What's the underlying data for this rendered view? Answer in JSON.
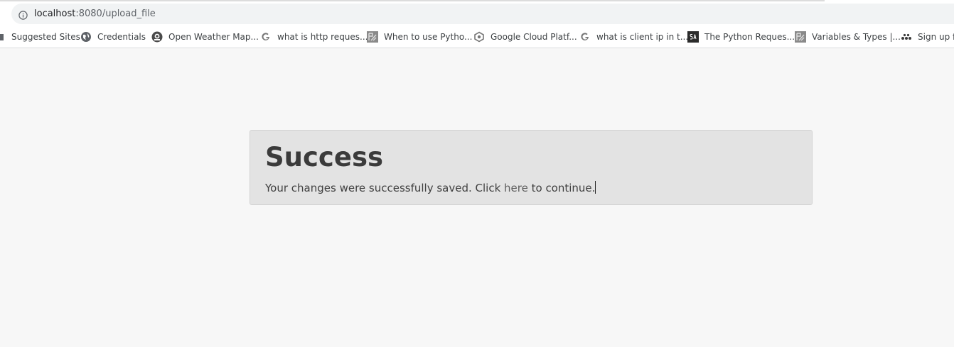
{
  "browser": {
    "url_host": "localhost",
    "url_path": ":8080/upload_file",
    "bookmarks": [
      {
        "label": "Suggested Sites",
        "icon": "suggested-sites-icon"
      },
      {
        "label": "Credentials",
        "icon": "globe-icon"
      },
      {
        "label": "Open Weather Map...",
        "icon": "openweathermap-icon"
      },
      {
        "label": "what is http reques...",
        "icon": "google-icon"
      },
      {
        "label": "When to use Pytho...",
        "icon": "pycharm-icon"
      },
      {
        "label": "Google Cloud Platf...",
        "icon": "google-cloud-icon"
      },
      {
        "label": "what is client ip in t...",
        "icon": "google-icon"
      },
      {
        "label": "The Python Reques...",
        "icon": "site-sa-icon"
      },
      {
        "label": "Variables & Types |...",
        "icon": "pycharm-icon"
      },
      {
        "label": "Sign up fo",
        "icon": "dots-icon"
      }
    ]
  },
  "alert": {
    "title": "Success",
    "message_before": "Your changes were successfully saved. Click ",
    "link_text": "here",
    "message_after": " to continue."
  }
}
